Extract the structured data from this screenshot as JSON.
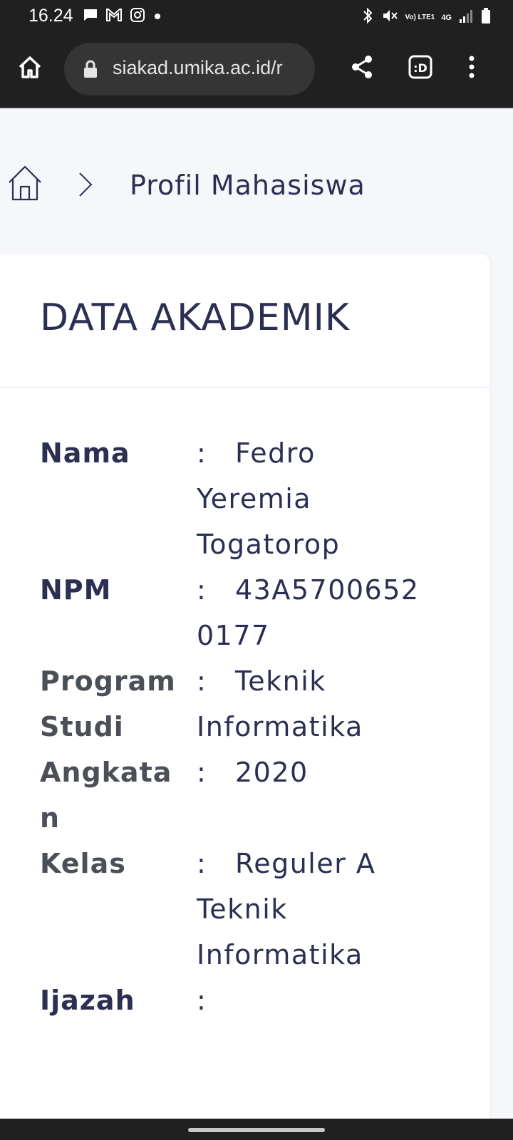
{
  "status_bar": {
    "time": "16.24",
    "left_icons": [
      "message-icon",
      "gmail-icon",
      "instagram-icon",
      "dot-icon"
    ],
    "right_icons": [
      "bluetooth-icon",
      "mute-icon",
      "volte-icon",
      "4g-icon",
      "signal-icon",
      "battery-icon"
    ],
    "network_labels": {
      "volte": "Vo) LTE1",
      "gen": "4G"
    }
  },
  "browser": {
    "url": "siakad.umika.ac.id/r"
  },
  "breadcrumb": {
    "label": "Profil Mahasiswa"
  },
  "card": {
    "title": "DATA AKADEMIK",
    "rows": [
      {
        "label": "Nama",
        "value": "Fedro Yeremia Togatorop"
      },
      {
        "label": "NPM",
        "value": "43A57006520177"
      },
      {
        "label": "Program Studi",
        "value": "Teknik Informatika"
      },
      {
        "label": "Angkatan",
        "value": "2020"
      },
      {
        "label": "Kelas",
        "value": "Reguler A Teknik Informatika"
      },
      {
        "label": "Ijazah",
        "value": ""
      }
    ],
    "separator": ":"
  },
  "colors": {
    "text": "#2b2f52",
    "background": "#f5f7fb",
    "bar": "#202020"
  }
}
